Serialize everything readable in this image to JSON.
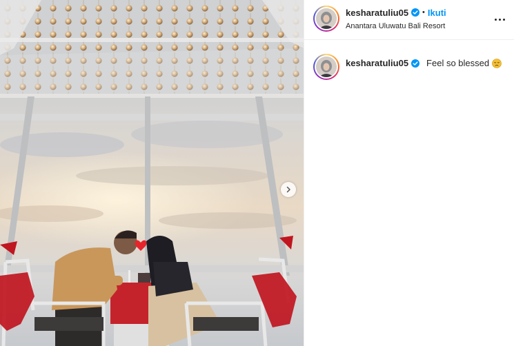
{
  "post": {
    "username": "kesharatuliu05",
    "separator": "•",
    "follow_label": "Ikuti",
    "location": "Anantara Uluwatu Bali Resort",
    "verified": true
  },
  "caption": {
    "username": "kesharatuliu05",
    "text": "Feel so blessed",
    "emoji": "pensive-face"
  },
  "media": {
    "carousel_next": "chevron-right-icon",
    "heart_overlay_color": "#e8242b"
  },
  "colors": {
    "accent": "#0095f6",
    "text": "#262626",
    "border": "#efefef"
  }
}
